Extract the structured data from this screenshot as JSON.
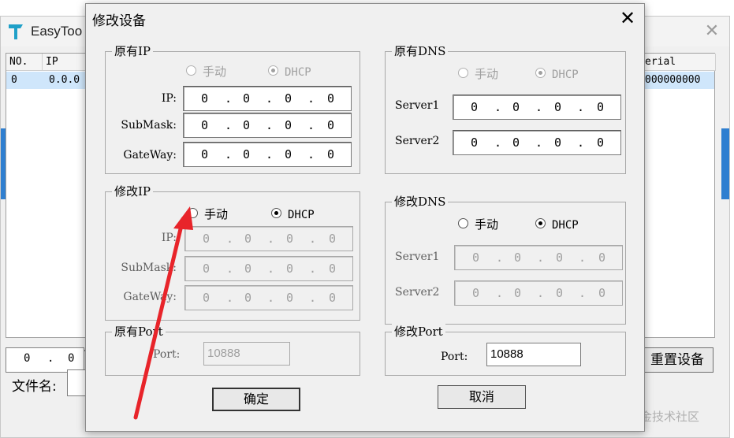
{
  "background_app": {
    "title": "EasyToo",
    "columns": [
      "NO.",
      "IP",
      "erial"
    ],
    "row": [
      "0",
      "0.0.0",
      "000000000"
    ],
    "ip_parts": [
      "0",
      ".",
      "0"
    ],
    "reset_button": "重置设备",
    "file_label": "文件名:"
  },
  "dialog": {
    "title": "修改设备",
    "close": "✕",
    "orig_ip": {
      "title": "原有IP",
      "manual": "手动",
      "dhcp": "DHCP",
      "selected": "dhcp",
      "ip_label": "IP:",
      "mask_label": "SubMask:",
      "gw_label": "GateWay:",
      "ip": [
        "0",
        "0",
        "0",
        "0"
      ],
      "mask": [
        "0",
        "0",
        "0",
        "0"
      ],
      "gw": [
        "0",
        "0",
        "0",
        "0"
      ]
    },
    "orig_dns": {
      "title": "原有DNS",
      "manual": "手动",
      "dhcp": "DHCP",
      "selected": "dhcp",
      "s1_label": "Server1",
      "s2_label": "Server2",
      "s1": [
        "0",
        "0",
        "0",
        "0"
      ],
      "s2": [
        "0",
        "0",
        "0",
        "0"
      ]
    },
    "mod_ip": {
      "title": "修改IP",
      "manual": "手动",
      "dhcp": "DHCP",
      "selected": "dhcp",
      "ip_label": "IP:",
      "mask_label": "SubMask:",
      "gw_label": "GateWay:",
      "ip": [
        "0",
        "0",
        "0",
        "0"
      ],
      "mask": [
        "0",
        "0",
        "0",
        "0"
      ],
      "gw": [
        "0",
        "0",
        "0",
        "0"
      ]
    },
    "mod_dns": {
      "title": "修改DNS",
      "manual": "手动",
      "dhcp": "DHCP",
      "selected": "dhcp",
      "s1_label": "Server1",
      "s2_label": "Server2",
      "s1": [
        "0",
        "0",
        "0",
        "0"
      ],
      "s2": [
        "0",
        "0",
        "0",
        "0"
      ]
    },
    "orig_port": {
      "title": "原有Port",
      "label": "Port:",
      "value": "10888"
    },
    "mod_port": {
      "title": "修改Port",
      "label": "Port:",
      "value": "10888"
    },
    "ok_button": "确定",
    "cancel_button": "取消"
  },
  "watermark": "@稀土掘金技术社区",
  "annotation": {
    "color": "#e8242a",
    "icon": "red-arrow-pointer"
  }
}
